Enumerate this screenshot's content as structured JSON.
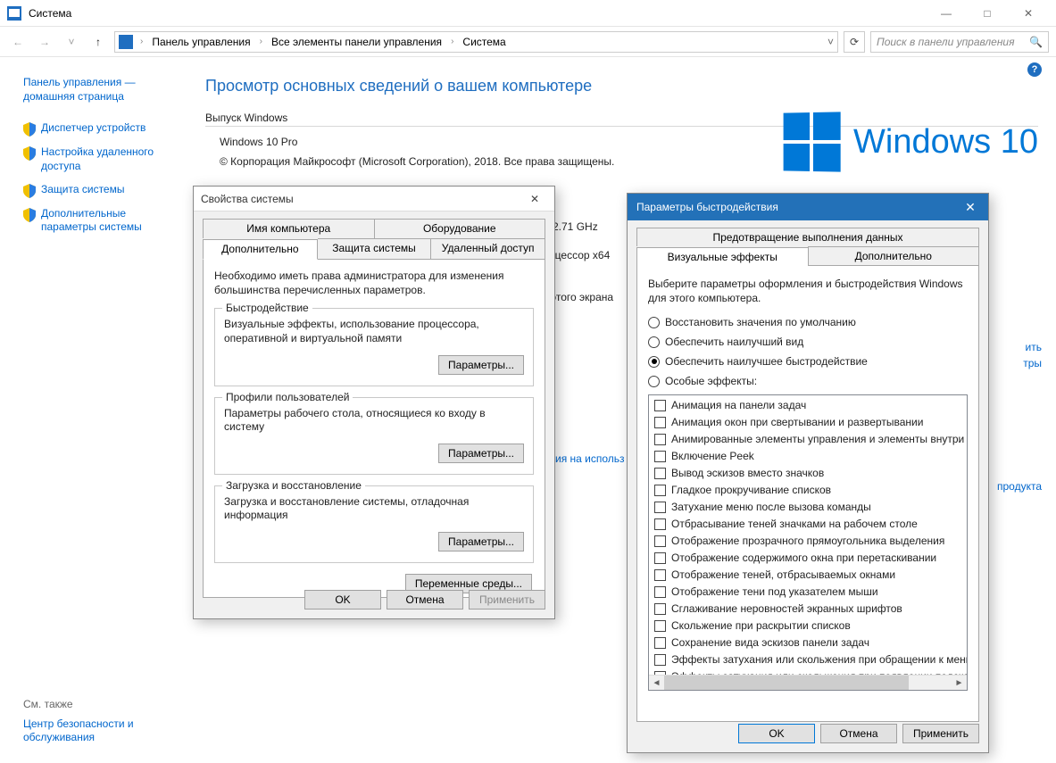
{
  "window": {
    "title": "Система",
    "minimize": "—",
    "maximize": "□",
    "close": "✕"
  },
  "nav": {
    "back": "←",
    "forward": "→",
    "up": "↑",
    "dropdown": "˅",
    "refresh": "⟳",
    "crumbs": [
      "Панель управления",
      "Все элементы панели управления",
      "Система"
    ],
    "search_placeholder": "Поиск в панели управления"
  },
  "help": "?",
  "sidebar": {
    "cp_home": "Панель управления — домашняя страница",
    "items": [
      "Диспетчер устройств",
      "Настройка удаленного доступа",
      "Защита системы",
      "Дополнительные параметры системы"
    ],
    "see_also_head": "См. также",
    "see_also_link": "Центр безопасности и обслуживания"
  },
  "content": {
    "title": "Просмотр основных сведений о вашем компьютере",
    "edition_head": "Выпуск Windows",
    "edition": "Windows 10 Pro",
    "copyright": "© Корпорация Майкрософт (Microsoft Corporation), 2018. Все права защищены.",
    "logo_text": "Windows 10",
    "partial_ghz": "2.71 GHz",
    "partial_arch": "оцессор x64",
    "partial_screen": "этого экрана",
    "partial_link1": "ить",
    "partial_link2": "тры",
    "partial_usage": "ия на использ",
    "partial_product": "продукта"
  },
  "dlg1": {
    "title": "Свойства системы",
    "tabs_row1": [
      "Имя компьютера",
      "Оборудование"
    ],
    "tabs_row2": [
      "Дополнительно",
      "Защита системы",
      "Удаленный доступ"
    ],
    "active_tab": "Дополнительно",
    "desc": "Необходимо иметь права администратора для изменения большинства перечисленных параметров.",
    "groups": [
      {
        "legend": "Быстродействие",
        "text": "Визуальные эффекты, использование процессора, оперативной и виртуальной памяти",
        "btn": "Параметры..."
      },
      {
        "legend": "Профили пользователей",
        "text": "Параметры рабочего стола, относящиеся ко входу в систему",
        "btn": "Параметры..."
      },
      {
        "legend": "Загрузка и восстановление",
        "text": "Загрузка и восстановление системы, отладочная информация",
        "btn": "Параметры..."
      }
    ],
    "env_btn": "Переменные среды...",
    "ok": "OK",
    "cancel": "Отмена",
    "apply": "Применить"
  },
  "dlg2": {
    "title": "Параметры быстродействия",
    "tab_dep": "Предотвращение выполнения данных",
    "tab_vis": "Визуальные эффекты",
    "tab_adv": "Дополнительно",
    "desc": "Выберите параметры оформления и быстродействия Windows для этого компьютера.",
    "radios": [
      {
        "label": "Восстановить значения по умолчанию",
        "checked": false
      },
      {
        "label": "Обеспечить наилучший вид",
        "checked": false
      },
      {
        "label": "Обеспечить наилучшее быстродействие",
        "checked": true
      },
      {
        "label": "Особые эффекты:",
        "checked": false
      }
    ],
    "checks": [
      "Анимация на панели задач",
      "Анимация окон при свертывании и развертывании",
      "Анимированные элементы управления и элементы внутри окн",
      "Включение Peek",
      "Вывод эскизов вместо значков",
      "Гладкое прокручивание списков",
      "Затухание меню после вызова команды",
      "Отбрасывание теней значками на рабочем столе",
      "Отображение прозрачного прямоугольника выделения",
      "Отображение содержимого окна при перетаскивании",
      "Отображение теней, отбрасываемых окнами",
      "Отображение тени под указателем мыши",
      "Сглаживание неровностей экранных шрифтов",
      "Скольжение при раскрытии списков",
      "Сохранение вида эскизов панели задач",
      "Эффекты затухания или скольжения при обращении к меню",
      "Эффекты затухания или скольжения при появлении подсказок"
    ],
    "ok": "OK",
    "cancel": "Отмена",
    "apply": "Применить"
  }
}
